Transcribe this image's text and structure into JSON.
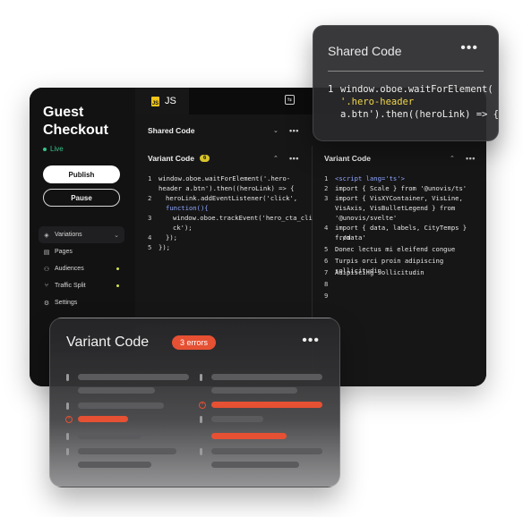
{
  "app": {
    "title_line1": "Guest",
    "title_line2": "Checkout",
    "status": "Live",
    "publish_label": "Publish",
    "pause_label": "Pause",
    "nav": [
      {
        "label": "Variations"
      },
      {
        "label": "Pages"
      },
      {
        "label": "Audiences"
      },
      {
        "label": "Traffic Split"
      },
      {
        "label": "Settings"
      }
    ]
  },
  "editor": {
    "tab_label": "JS",
    "shared_code_label": "Shared Code",
    "left_panel": {
      "title": "Variant Code",
      "badge": "6",
      "lines": [
        {
          "n": "1",
          "text": "window.oboe.waitForElement('.hero-",
          "text2": "header a.btn').then((heroLink) => {"
        },
        {
          "n": "2",
          "text": "heroLink.addEventListener('click',",
          "text2": "function(){"
        },
        {
          "n": "3",
          "text": "window.oboe.trackEvent('hero_cta_cli",
          "text2": "ck');"
        },
        {
          "n": "4",
          "text": "});"
        },
        {
          "n": "5",
          "text": "});"
        }
      ]
    },
    "right_panel": {
      "title": "Variant Code",
      "lines": [
        {
          "n": "1",
          "text": "<script lang='ts'>"
        },
        {
          "n": "2",
          "text": "import { Scale } from '@unovis/ts'"
        },
        {
          "n": "3",
          "text": "import { VisXYContainer, VisLine,",
          "text2": "VisAxis, VisBulletLegend } from",
          "text3": "'@unovis/svelte'"
        },
        {
          "n": "4",
          "text": "import { data, labels, CityTemps } from",
          "text2": "'./data'"
        },
        {
          "n": "5",
          "text": "Donec lectus mi eleifend congue"
        },
        {
          "n": "6",
          "text": "Turpis orci proin adipiscing sollicitudin"
        },
        {
          "n": "7",
          "text": "Adipiscing sollicitudin"
        },
        {
          "n": "8",
          "text": ""
        },
        {
          "n": "9",
          "text": ""
        }
      ]
    }
  },
  "shared_card": {
    "title": "Shared Code",
    "line_number": "1",
    "line1": "window.oboe.waitForElement(",
    "line2": "'.hero-header",
    "line3": "a.btn').then((heroLink) => {"
  },
  "variant_card": {
    "title": "Variant Code",
    "errors_label": "3 errors"
  },
  "colors": {
    "accent_red": "#e65033",
    "live_green": "#36c28a",
    "badge_yellow": "#d8c42b"
  }
}
